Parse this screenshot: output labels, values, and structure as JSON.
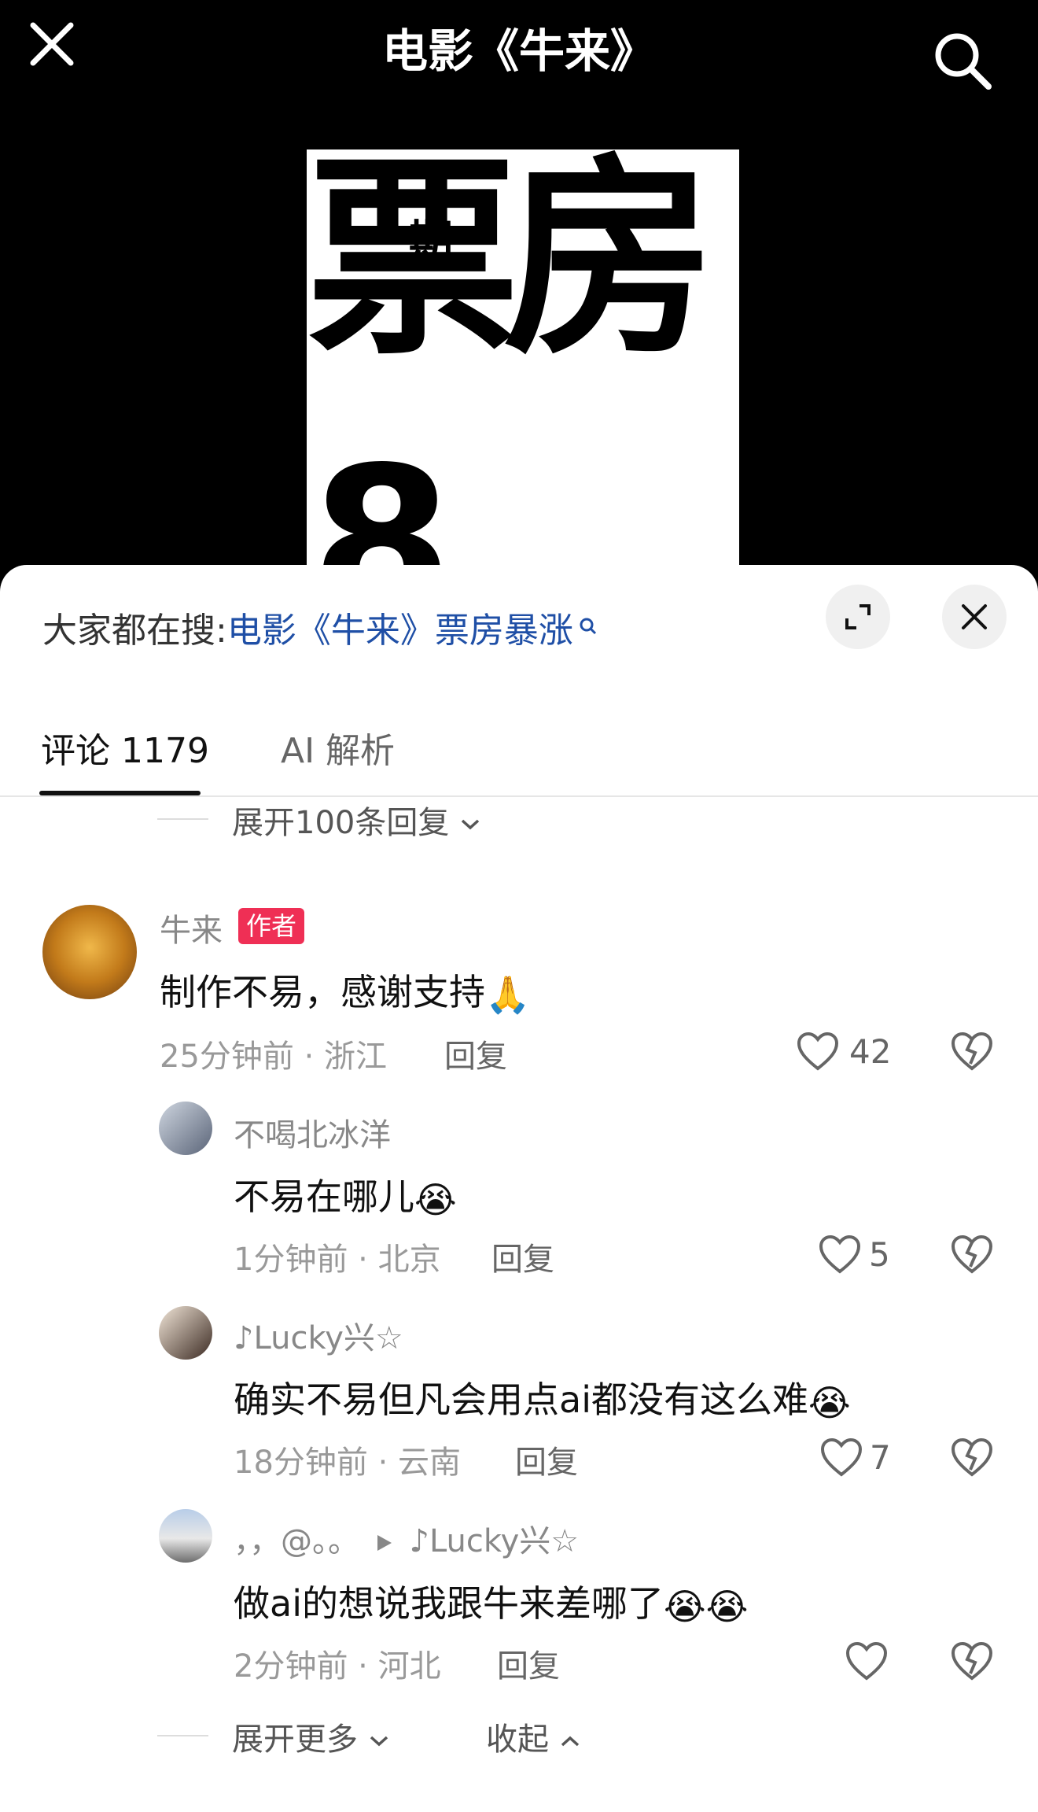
{
  "video": {
    "title": "电影《牛来》",
    "poster_big": "票房",
    "poster_small": "期",
    "poster_bottom": "8"
  },
  "hot_search": {
    "label": "大家都在搜:",
    "query": "电影《牛来》票房暴涨"
  },
  "tabs": [
    {
      "label": "评论 1179"
    },
    {
      "label": "AI 解析"
    }
  ],
  "expand_replies": "展开100条回复",
  "comments": [
    {
      "user": "牛来",
      "badge": "作者",
      "text": "制作不易，感谢支持",
      "emoji": "🙏",
      "meta": "25分钟前 · 浙江",
      "reply": "回复",
      "likes": "42"
    },
    {
      "user": "不喝北冰洋",
      "text": "不易在哪儿",
      "emoji": "😭",
      "meta": "1分钟前 · 北京",
      "reply": "回复",
      "likes": "5"
    },
    {
      "user": "♪Lucky兴☆",
      "text": "确实不易但凡会用点ai都没有这么难",
      "emoji": "😭",
      "meta": "18分钟前 · 云南",
      "reply": "回复",
      "likes": "7"
    },
    {
      "user": "，，@。。",
      "reply_to": "♪Lucky兴☆",
      "text": "做ai的想说我跟牛来差哪了",
      "emoji": "😭😭",
      "meta": "2分钟前 · 河北",
      "reply": "回复",
      "likes": ""
    }
  ],
  "footer": {
    "expand_more": "展开更多",
    "collapse": "收起"
  }
}
